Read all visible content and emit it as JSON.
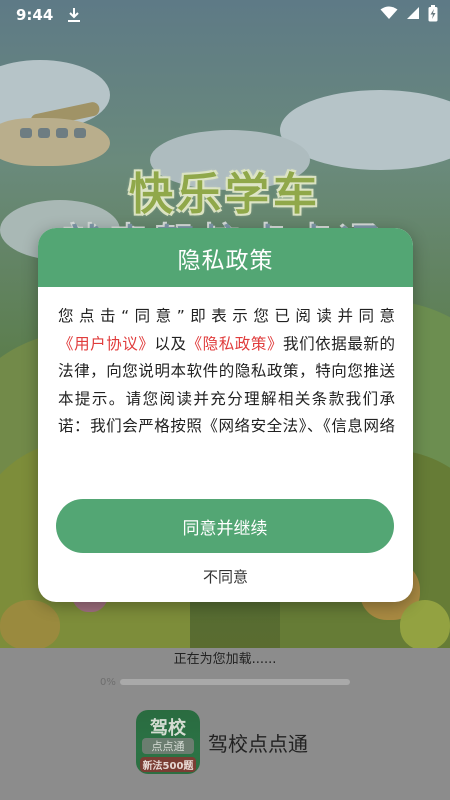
{
  "status_bar": {
    "time": "9:44",
    "download_icon": "download-icon",
    "wifi_icon": "wifi-icon",
    "signal_icon": "cellular-signal-icon",
    "battery_icon": "battery-charging-icon"
  },
  "splash": {
    "title": "快乐学车",
    "subtitle": "就来驾校点点通"
  },
  "dialog": {
    "title": "隐私政策",
    "body_part1": "您点击“同意”即表示您已阅读并同意",
    "user_agreement_link": "《用户协议》",
    "body_part2": "以及",
    "privacy_policy_link": "《隐私政策》",
    "body_part3": "我们依据最新的法律，向您说明本软件的隐私政策，特向您推送本提示。请您阅读并充分理解相关条款我们承诺：我们会严格按照《网络安全法》、《信息网络传播权保护条例》等保护您的个人信息。",
    "agree_label": "同意并继续",
    "decline_label": "不同意"
  },
  "loading": {
    "text": "正在为您加载......",
    "percent_label": "0%",
    "progress": 0
  },
  "app": {
    "logo_main": "驾校",
    "logo_sub": "点点通",
    "logo_badge": "新法500题",
    "name": "驾校点点通"
  },
  "colors": {
    "accent_green": "#53a674",
    "link_red": "#e03c3c",
    "dialog_bg": "#ffffff"
  }
}
